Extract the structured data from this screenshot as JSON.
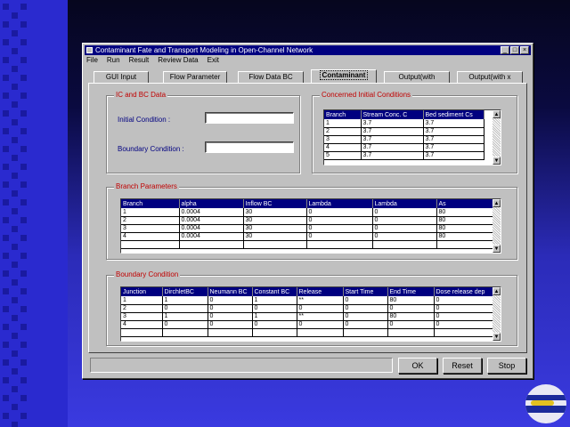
{
  "window": {
    "title": "Contaminant Fate and Transport Modeling in Open-Channel Network",
    "min": "_",
    "max": "□",
    "close": "×"
  },
  "menu": [
    "File",
    "Run",
    "Result",
    "Review Data",
    "Exit"
  ],
  "tabs": [
    "GUI Input",
    "Flow Parameter",
    "Flow Data BC",
    "Contaminant",
    "Output(with",
    "Output(with x"
  ],
  "active_tab": 3,
  "ic_bc": {
    "title": "IC and BC Data",
    "initial_label": "Initial   Condition :",
    "boundary_label": "Boundary  Condition :",
    "initial_value": "",
    "boundary_value": ""
  },
  "initial_conditions": {
    "title": "Concerned Initial Conditions",
    "columns": [
      "Branch",
      "Stream Conc. C",
      "Bed sediment Cs"
    ],
    "rows": [
      [
        "1",
        "3.7",
        "3.7"
      ],
      [
        "2",
        "3.7",
        "3.7"
      ],
      [
        "3",
        "3.7",
        "3.7"
      ],
      [
        "4",
        "3.7",
        "3.7"
      ],
      [
        "5",
        "3.7",
        "3.7"
      ]
    ]
  },
  "branch_params": {
    "title": "Branch Parameters",
    "columns": [
      "Branch",
      "alpha",
      "Inflow BC",
      "Lambda",
      "Lambda",
      "As"
    ],
    "rows": [
      [
        "1",
        "0.0004",
        "30",
        "0",
        "0",
        "80"
      ],
      [
        "2",
        "0.0004",
        "30",
        "0",
        "0",
        "80"
      ],
      [
        "3",
        "0.0004",
        "30",
        "0",
        "0",
        "80"
      ],
      [
        "4",
        "0.0004",
        "30",
        "0",
        "0",
        "80"
      ],
      [
        "",
        "",
        "",
        "",
        "",
        ""
      ]
    ]
  },
  "boundary": {
    "title": "Boundary Condition",
    "columns": [
      "Junction",
      "DirchletBC",
      "Neumann BC",
      "Constant BC",
      "Release",
      "Start Time",
      "End Time",
      "Dose release dep"
    ],
    "rows": [
      [
        "1",
        "1",
        "0",
        "1",
        "**",
        "0",
        "80",
        "0"
      ],
      [
        "2",
        "0",
        "0",
        "0",
        "0",
        "0",
        "0",
        "0"
      ],
      [
        "3",
        "1",
        "0",
        "1",
        "**",
        "0",
        "80",
        "0"
      ],
      [
        "4",
        "0",
        "0",
        "0",
        "0",
        "0",
        "0",
        "0"
      ],
      [
        "",
        "",
        "",
        "",
        "",
        "",
        "",
        ""
      ]
    ]
  },
  "buttons": {
    "ok": "OK",
    "reset": "Reset",
    "stop": "Stop"
  },
  "status_text": "",
  "colors": {
    "title_bar": "#000080",
    "group_title": "#c00000",
    "background": "#2a2acf"
  }
}
